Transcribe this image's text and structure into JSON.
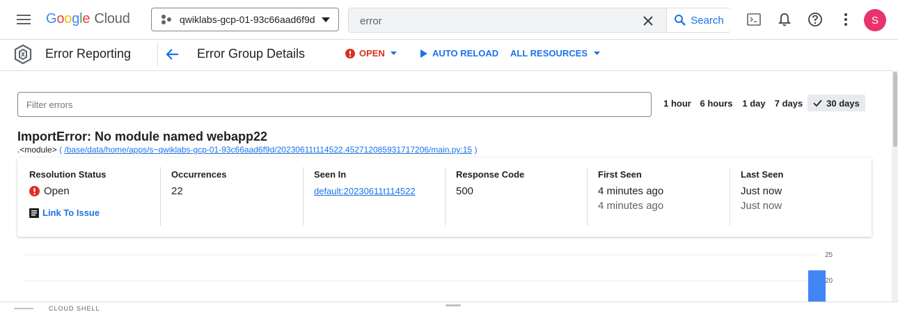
{
  "topbar": {
    "logo_google": [
      "G",
      "o",
      "o",
      "g",
      "l",
      "e"
    ],
    "logo_cloud": "Cloud",
    "project": "qwiklabs-gcp-01-93c66aad6f9d",
    "search_value": "error",
    "search_label": "Search",
    "avatar_letter": "S"
  },
  "subbar": {
    "product": "Error Reporting",
    "page_title": "Error Group Details",
    "status": "OPEN",
    "auto_reload": "AUTO RELOAD",
    "all_resources": "ALL RESOURCES"
  },
  "filter": {
    "placeholder": "Filter errors",
    "ranges": [
      "1 hour",
      "6 hours",
      "1 day",
      "7 days",
      "30 days"
    ],
    "active_range": "30 days"
  },
  "error": {
    "title": "ImportError: No module named webapp22",
    "module": ".<module>",
    "open_paren": "(",
    "path": "/base/data/home/apps/s~qwiklabs-gcp-01-93c66aad6f9d/20230611t114522.452712085931717206/main.py:15",
    "close_paren": ")"
  },
  "stats": {
    "resolution_status": {
      "header": "Resolution Status",
      "value": "Open",
      "link": "Link To Issue"
    },
    "occurrences": {
      "header": "Occurrences",
      "value": "22"
    },
    "seen_in": {
      "header": "Seen In",
      "value": "default:20230611t114522"
    },
    "response_code": {
      "header": "Response Code",
      "value": "500"
    },
    "first_seen": {
      "header": "First Seen",
      "value": "4 minutes ago",
      "sub": "4 minutes ago"
    },
    "last_seen": {
      "header": "Last Seen",
      "value": "Just now",
      "sub": "Just now"
    }
  },
  "chart_data": {
    "type": "bar",
    "y_ticks": [
      "25",
      "20"
    ],
    "ylim": [
      0,
      25
    ],
    "values": [
      22
    ],
    "bar_color": "#4285f4"
  },
  "bottombar": {
    "label": "CLOUD SHELL"
  },
  "colors": {
    "accent": "#1a73e8",
    "error": "#d93025",
    "avatar": "#e8336d"
  }
}
